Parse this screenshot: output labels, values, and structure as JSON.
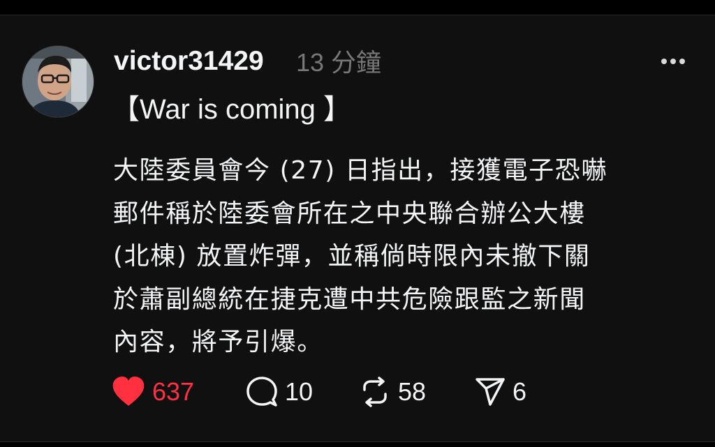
{
  "post": {
    "author": {
      "username": "victor31429",
      "avatar": "avatar-photo"
    },
    "timestamp": "13 分鐘",
    "more_icon": "more-horizontal-icon",
    "title": "【War is coming 】",
    "body_lines": [
      "大陸委員會今 (27) 日指出，接獲電子恐嚇",
      "郵件稱於陸委會所在之中央聯合辦公大樓",
      "(北棟) 放置炸彈，並稱倘時限內未撤下關",
      "於蕭副總統在捷克遭中共危險跟監之新聞",
      "內容，將予引爆。"
    ],
    "actions": {
      "like": {
        "icon": "heart-filled-icon",
        "count": "637",
        "color": "#ff3040",
        "liked": true
      },
      "reply": {
        "icon": "comment-icon",
        "count": "10"
      },
      "repost": {
        "icon": "repost-icon",
        "count": "58"
      },
      "share": {
        "icon": "send-icon",
        "count": "6"
      }
    }
  },
  "colors": {
    "background": "#101010",
    "text": "#f3f5f7",
    "muted": "#777777",
    "like": "#ff3040"
  }
}
